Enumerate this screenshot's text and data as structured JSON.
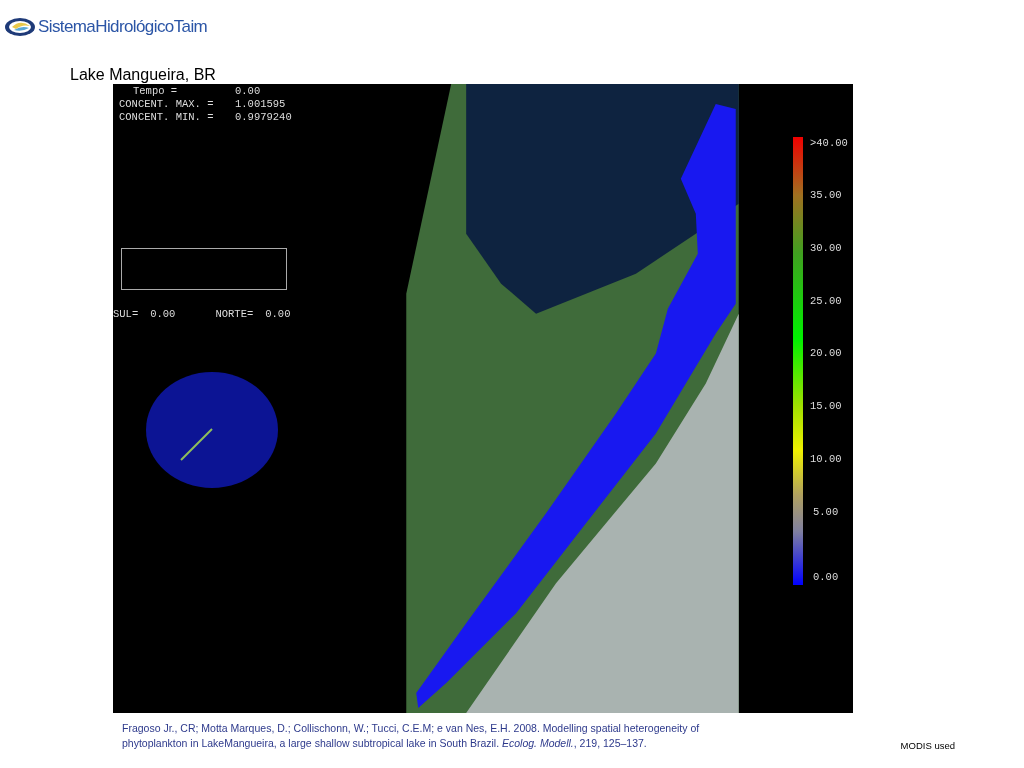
{
  "header": {
    "logo_text": "SistemaHidrológicoTaim"
  },
  "title": "Lake Mangueira, BR",
  "simulation": {
    "readouts": [
      {
        "label": "Tempo =",
        "value": "0.00"
      },
      {
        "label": "CONCENT. MAX. =",
        "value": "1.001595"
      },
      {
        "label": "CONCENT. MIN. =",
        "value": "0.9979240"
      }
    ],
    "boundary": [
      {
        "label": "SUL=",
        "value": "0.00"
      },
      {
        "label": "NORTE=",
        "value": "0.00"
      }
    ],
    "legend": {
      "labels": [
        ">40.00",
        "35.00",
        "30.00",
        "25.00",
        "20.00",
        "15.00",
        "10.00",
        "5.00",
        "0.00"
      ]
    }
  },
  "citation": "Fragoso Jr., CR; Motta Marques, D.; Collischonn, W.; Tucci, C.E.M; e  van Nes, E.H. 2008. Modelling  spatial heterogeneity of phytoplankton in LakeMangueira, a large shallow subtropical lake in South Brazil. *Ecolog. Modell.*, 219, 125–137.",
  "note": "MODIS used"
}
